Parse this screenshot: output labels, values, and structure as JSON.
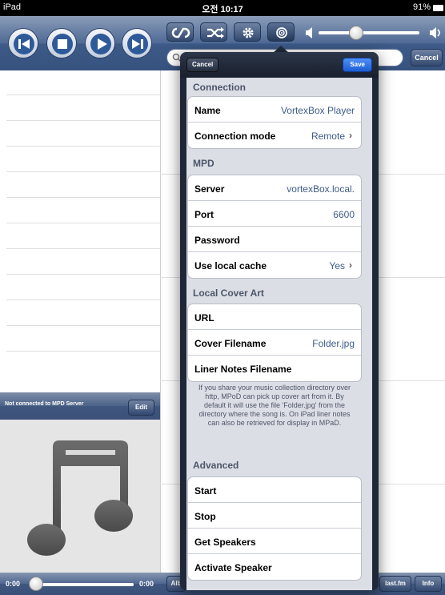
{
  "status": {
    "device": "iPad",
    "time": "오전 10:17",
    "battery": "91%"
  },
  "toolbar": {
    "transport": [
      "previous",
      "stop",
      "play",
      "next"
    ],
    "toggles": [
      "repeat",
      "shuffle",
      "settings",
      "outputs"
    ],
    "search_cancel": "Cancel"
  },
  "now_playing": {
    "status": "Not connected to MPD Server",
    "edit": "Edit"
  },
  "bottombar": {
    "elapsed": "0:00",
    "remaining": "0:00",
    "tab_albums": "Alb",
    "lastfm": "last.fm",
    "info": "Info"
  },
  "popover": {
    "cancel": "Cancel",
    "save": "Save",
    "sections": {
      "connection": {
        "title": "Connection",
        "name_label": "Name",
        "name_value": "VortexBox Player",
        "mode_label": "Connection mode",
        "mode_value": "Remote"
      },
      "mpd": {
        "title": "MPD",
        "server_label": "Server",
        "server_value": "vortexBox.local.",
        "port_label": "Port",
        "port_value": "6600",
        "password_label": "Password",
        "cache_label": "Use local cache",
        "cache_value": "Yes"
      },
      "cover": {
        "title": "Local Cover Art",
        "url_label": "URL",
        "filename_label": "Cover Filename",
        "filename_value": "Folder.jpg",
        "liner_label": "Liner Notes Filename",
        "note": "If you share your music collection directory over http, MPoD can pick up cover art from it. By default it will use the file 'Folder.jpg' from the directory where the song is. On iPad liner notes can also be retrieved for display in MPaD."
      },
      "advanced": {
        "title": "Advanced",
        "start": "Start",
        "stop": "Stop",
        "get_speakers": "Get Speakers",
        "activate_speaker": "Activate Speaker"
      }
    }
  }
}
